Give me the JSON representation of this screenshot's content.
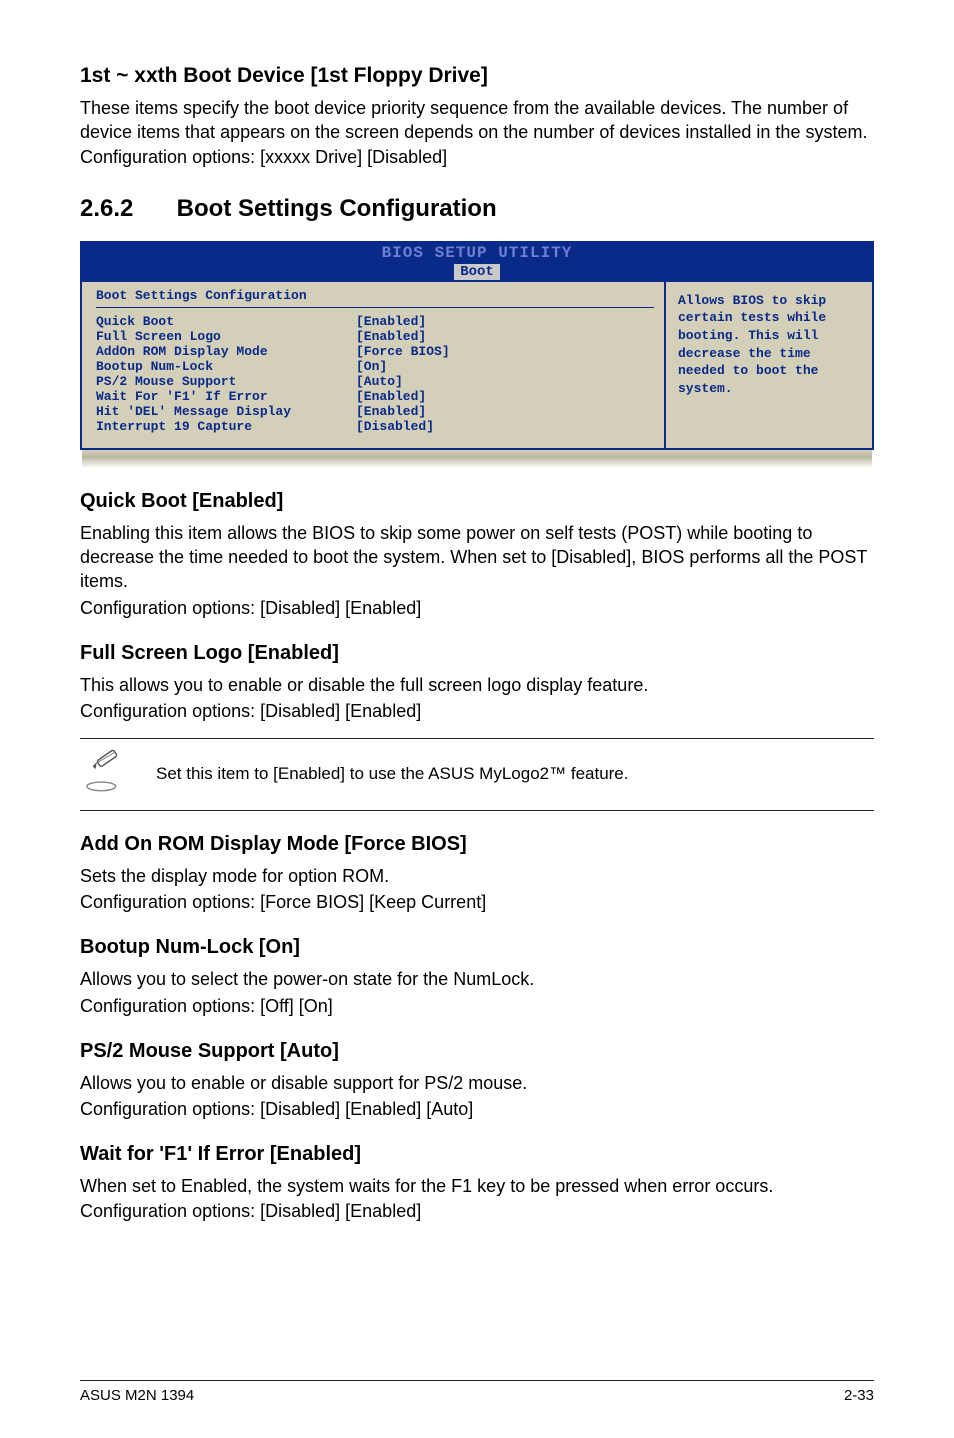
{
  "sect_boot_device": {
    "title": "1st ~ xxth Boot Device [1st Floppy Drive]",
    "para": "These items specify the boot device priority sequence from the available devices. The number of device items that appears on the screen depends on the number of devices installed in the system. Configuration options: [xxxxx Drive] [Disabled]"
  },
  "sect_num": {
    "number": "2.6.2",
    "title": "Boot Settings Configuration"
  },
  "bios": {
    "title_top": "BIOS SETUP UTILITY",
    "tab": "Boot",
    "panel_title": "Boot Settings Configuration",
    "rows": [
      {
        "label": "Quick Boot",
        "value": "[Enabled]"
      },
      {
        "label": "Full Screen Logo",
        "value": "[Enabled]"
      },
      {
        "label": "AddOn ROM Display Mode",
        "value": "[Force BIOS]"
      },
      {
        "label": "Bootup Num-Lock",
        "value": "[On]"
      },
      {
        "label": "PS/2 Mouse Support",
        "value": "[Auto]"
      },
      {
        "label": "Wait For 'F1' If Error",
        "value": "[Enabled]"
      },
      {
        "label": "Hit 'DEL' Message Display",
        "value": "[Enabled]"
      },
      {
        "label": "Interrupt 19 Capture",
        "value": "[Disabled]"
      }
    ],
    "help": "Allows BIOS to skip certain tests while booting. This will decrease the time needed to boot the system."
  },
  "quick_boot": {
    "title": "Quick Boot [Enabled]",
    "para1": "Enabling this item allows the BIOS to skip some power on self tests (POST) while booting to decrease the time needed to boot the system. When set to [Disabled], BIOS performs all the POST items.",
    "para2": "Configuration options: [Disabled] [Enabled]"
  },
  "full_screen_logo": {
    "title": "Full Screen Logo [Enabled]",
    "para1": "This allows you to enable or disable the full screen logo display feature.",
    "para2": "Configuration options: [Disabled] [Enabled]"
  },
  "note_text": "Set this item to [Enabled] to use the ASUS MyLogo2™ feature.",
  "addon_rom": {
    "title": "Add On ROM Display Mode [Force BIOS]",
    "para1": "Sets the display mode for option ROM.",
    "para2": "Configuration options: [Force BIOS] [Keep Current]"
  },
  "bootup_numlock": {
    "title": "Bootup Num-Lock [On]",
    "para1": "Allows you to select the power-on state for the NumLock.",
    "para2": "Configuration options: [Off] [On]"
  },
  "ps2_mouse": {
    "title": "PS/2 Mouse Support [Auto]",
    "para1": "Allows you to enable or disable support for PS/2 mouse.",
    "para2": "Configuration options: [Disabled] [Enabled] [Auto]"
  },
  "wait_f1": {
    "title": "Wait for 'F1' If Error [Enabled]",
    "para": "When set to Enabled, the system waits for the F1 key to be pressed when error occurs. Configuration options: [Disabled] [Enabled]"
  },
  "footer": {
    "left": "ASUS M2N 1394",
    "right": "2-33"
  }
}
